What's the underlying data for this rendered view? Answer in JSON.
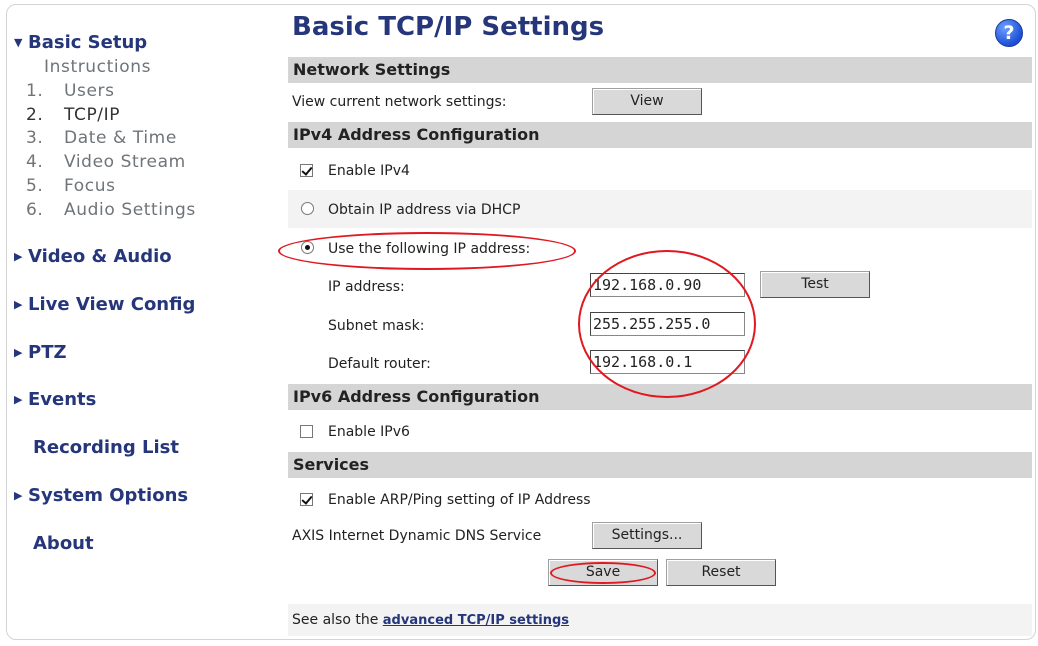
{
  "sidebar": {
    "basic_setup": "Basic Setup",
    "sub_items": [
      {
        "num": "",
        "label": "Instructions"
      },
      {
        "num": "1.",
        "label": "Users"
      },
      {
        "num": "2.",
        "label": "TCP/IP"
      },
      {
        "num": "3.",
        "label": "Date & Time"
      },
      {
        "num": "4.",
        "label": "Video Stream"
      },
      {
        "num": "5.",
        "label": "Focus"
      },
      {
        "num": "6.",
        "label": "Audio Settings"
      }
    ],
    "sections": [
      "Video & Audio",
      "Live View Config",
      "PTZ",
      "Events",
      "Recording List",
      "System Options",
      "About"
    ]
  },
  "page_title": "Basic TCP/IP Settings",
  "help_icon": "?",
  "network": {
    "header": "Network Settings",
    "view_label": "View current network settings:",
    "view_button": "View"
  },
  "ipv4": {
    "header": "IPv4 Address Configuration",
    "enable_label": "Enable IPv4",
    "enable_checked": true,
    "dhcp_label": "Obtain IP address via DHCP",
    "static_label": "Use the following IP address:",
    "static_selected": true,
    "ip_label": "IP address:",
    "ip_value": "192.168.0.90",
    "test_button": "Test",
    "subnet_label": "Subnet mask:",
    "subnet_value": "255.255.255.0",
    "router_label": "Default router:",
    "router_value": "192.168.0.1"
  },
  "ipv6": {
    "header": "IPv6 Address Configuration",
    "enable_label": "Enable IPv6",
    "enable_checked": false
  },
  "services": {
    "header": "Services",
    "arp_label": "Enable ARP/Ping setting of IP Address",
    "arp_checked": true,
    "ddns_label": "AXIS Internet Dynamic DNS Service",
    "settings_button": "Settings..."
  },
  "actions": {
    "save": "Save",
    "reset": "Reset"
  },
  "footer": {
    "see_also": "See also the",
    "link": "advanced TCP/IP settings"
  },
  "colors": {
    "nav_blue": "#25367a",
    "annotation_red": "#e01820"
  }
}
